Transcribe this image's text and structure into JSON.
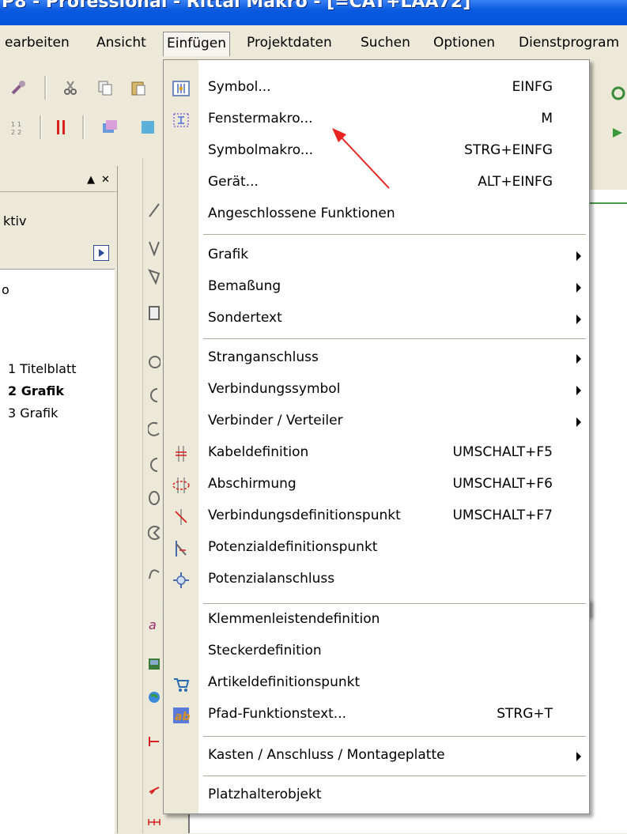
{
  "window": {
    "title": "P8 - Professional - Rittal Makro - [=CAT+LAA72]"
  },
  "menubar": {
    "items": [
      {
        "label": "earbeiten"
      },
      {
        "label": "Ansicht"
      },
      {
        "label": "Einfügen"
      },
      {
        "label": "Projektdaten"
      },
      {
        "label": "Suchen"
      },
      {
        "label": "Optionen"
      },
      {
        "label": "Dienstprogram"
      }
    ]
  },
  "left_panel": {
    "partial_label": "ktiv",
    "partial_item": "o",
    "pages": [
      {
        "label": "1 Titelblatt"
      },
      {
        "label": "2 Grafik"
      },
      {
        "label": "3 Grafik"
      }
    ]
  },
  "insert_menu": {
    "items": [
      {
        "label": "Symbol...",
        "shortcut": "EINFG",
        "icon": "symbol-icon"
      },
      {
        "label": "Fenstermakro...",
        "shortcut": "M",
        "icon": "window-macro-icon"
      },
      {
        "label": "Symbolmakro...",
        "shortcut": "STRG+EINFG"
      },
      {
        "label": "Gerät...",
        "shortcut": "ALT+EINFG"
      },
      {
        "label": "Angeschlossene Funktionen"
      },
      {
        "label": "Grafik",
        "submenu": true
      },
      {
        "label": "Bemaßung",
        "submenu": true
      },
      {
        "label": "Sondertext",
        "submenu": true
      },
      {
        "label": "Stranganschluss",
        "submenu": true
      },
      {
        "label": "Verbindungssymbol",
        "submenu": true
      },
      {
        "label": "Verbinder / Verteiler",
        "submenu": true
      },
      {
        "label": "Kabeldefinition",
        "shortcut": "UMSCHALT+F5",
        "icon": "cable-definition-icon"
      },
      {
        "label": "Abschirmung",
        "shortcut": "UMSCHALT+F6",
        "icon": "shielding-icon"
      },
      {
        "label": "Verbindungsdefinitionspunkt",
        "shortcut": "UMSCHALT+F7",
        "icon": "connection-definition-point-icon"
      },
      {
        "label": "Potenzialdefinitionspunkt",
        "icon": "potential-definition-point-icon"
      },
      {
        "label": "Potenzialanschluss",
        "icon": "potential-connection-icon"
      },
      {
        "label": "Klemmenleistendefinition"
      },
      {
        "label": "Steckerdefinition"
      },
      {
        "label": "Artikeldefinitionspunkt",
        "icon": "part-definition-point-icon"
      },
      {
        "label": "Pfad-Funktionstext...",
        "shortcut": "STRG+T",
        "icon": "path-function-text-icon"
      },
      {
        "label": "Kasten / Anschluss / Montageplatte",
        "submenu": true
      },
      {
        "label": "Platzhalterobjekt"
      }
    ]
  },
  "colors": {
    "annotation_arrow": "#e8231f",
    "titlebar": "#0a5ae0",
    "menu_gutter": "#ece9d8"
  }
}
